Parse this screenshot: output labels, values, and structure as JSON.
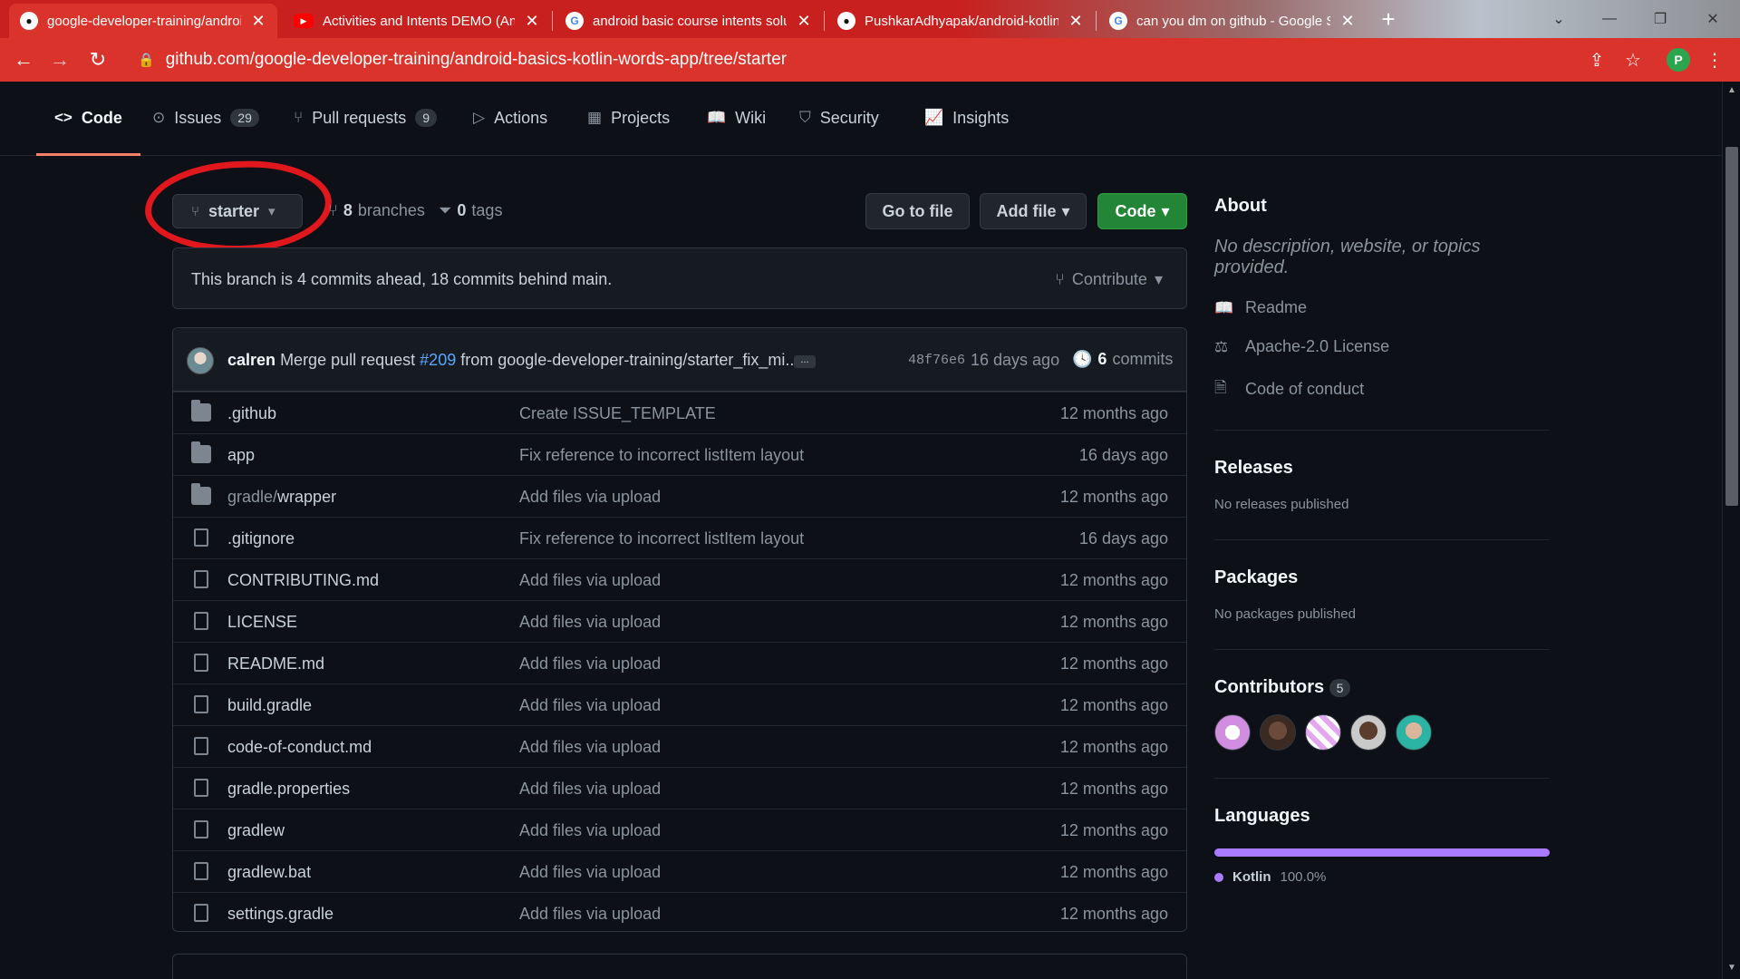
{
  "browser": {
    "tabs": [
      {
        "title": "google-developer-training/android",
        "favicon": "github-icon"
      },
      {
        "title": "Activities and Intents DEMO (Andr",
        "favicon": "youtube-icon"
      },
      {
        "title": "android basic course intents solu",
        "favicon": "google-icon"
      },
      {
        "title": "PushkarAdhyapak/android-kotlin",
        "favicon": "github-icon"
      },
      {
        "title": "can you dm on github - Google S",
        "favicon": "google-icon"
      }
    ],
    "url": "github.com/google-developer-training/android-basics-kotlin-words-app/tree/starter",
    "profile_initial": "P",
    "accent_color": "#d9332c"
  },
  "repo_nav": {
    "code": "Code",
    "issues": "Issues",
    "issues_count": "29",
    "pulls": "Pull requests",
    "pulls_count": "9",
    "actions": "Actions",
    "projects": "Projects",
    "wiki": "Wiki",
    "security": "Security",
    "insights": "Insights"
  },
  "branch_bar": {
    "branch": "starter",
    "branches_count": "8",
    "branches_label": "branches",
    "tags_count": "0",
    "tags_label": "tags",
    "go_to_file": "Go to file",
    "add_file": "Add file",
    "code": "Code"
  },
  "branch_info": {
    "message": "This branch is 4 commits ahead, 18 commits behind main.",
    "contribute": "Contribute"
  },
  "latest_commit": {
    "author": "calren",
    "message_prefix": "Merge pull request",
    "pr": "#209",
    "message_suffix": "from google-developer-training/starter_fix_mi...",
    "ellipsis": "...",
    "sha": "48f76e6",
    "time": "16 days ago",
    "commits_count": "6",
    "commits_label": "commits"
  },
  "files": [
    {
      "type": "dir",
      "name": ".github",
      "message": "Create ISSUE_TEMPLATE",
      "age": "12 months ago"
    },
    {
      "type": "dir",
      "name": "app",
      "message": "Fix reference to incorrect listItem layout",
      "age": "16 days ago"
    },
    {
      "type": "dir",
      "name_dim": "gradle/",
      "name": "wrapper",
      "message": "Add files via upload",
      "age": "12 months ago"
    },
    {
      "type": "file",
      "name": ".gitignore",
      "message": "Fix reference to incorrect listItem layout",
      "age": "16 days ago"
    },
    {
      "type": "file",
      "name": "CONTRIBUTING.md",
      "message": "Add files via upload",
      "age": "12 months ago"
    },
    {
      "type": "file",
      "name": "LICENSE",
      "message": "Add files via upload",
      "age": "12 months ago"
    },
    {
      "type": "file",
      "name": "README.md",
      "message": "Add files via upload",
      "age": "12 months ago"
    },
    {
      "type": "file",
      "name": "build.gradle",
      "message": "Add files via upload",
      "age": "12 months ago"
    },
    {
      "type": "file",
      "name": "code-of-conduct.md",
      "message": "Add files via upload",
      "age": "12 months ago"
    },
    {
      "type": "file",
      "name": "gradle.properties",
      "message": "Add files via upload",
      "age": "12 months ago"
    },
    {
      "type": "file",
      "name": "gradlew",
      "message": "Add files via upload",
      "age": "12 months ago"
    },
    {
      "type": "file",
      "name": "gradlew.bat",
      "message": "Add files via upload",
      "age": "12 months ago"
    },
    {
      "type": "file",
      "name": "settings.gradle",
      "message": "Add files via upload",
      "age": "12 months ago"
    }
  ],
  "sidebar": {
    "about": "About",
    "description": "No description, website, or topics provided.",
    "readme": "Readme",
    "license": "Apache-2.0 License",
    "conduct": "Code of conduct",
    "releases": "Releases",
    "releases_note": "No releases published",
    "packages": "Packages",
    "packages_note": "No packages published",
    "contributors": "Contributors",
    "contributors_count": "5",
    "languages": "Languages",
    "language": "Kotlin",
    "language_pct": "100.0%",
    "language_color": "#a97bff"
  }
}
